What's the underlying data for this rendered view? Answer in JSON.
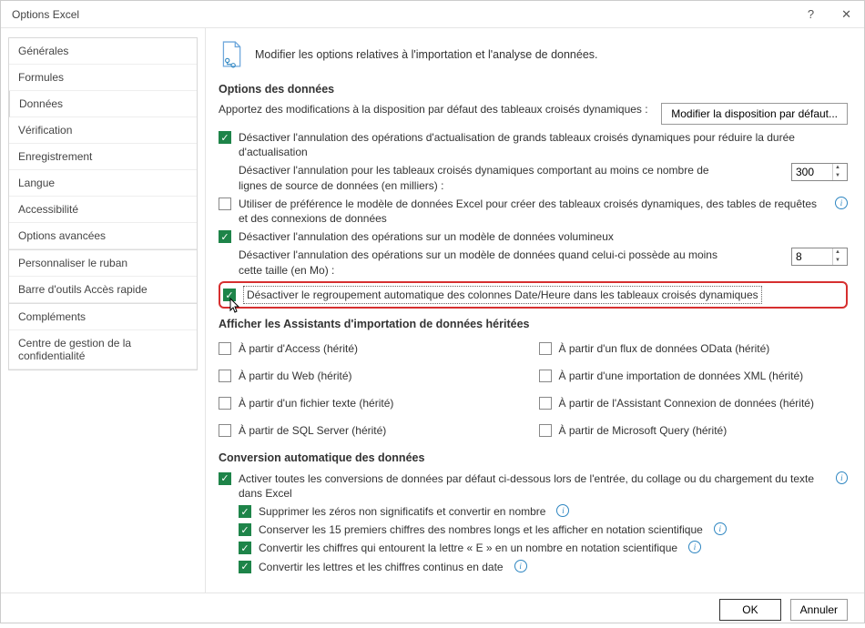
{
  "window": {
    "title": "Options Excel",
    "help": "?",
    "close": "✕"
  },
  "sidebar": {
    "items": [
      {
        "label": "Générales"
      },
      {
        "label": "Formules"
      },
      {
        "label": "Données"
      },
      {
        "label": "Vérification"
      },
      {
        "label": "Enregistrement"
      },
      {
        "label": "Langue"
      },
      {
        "label": "Accessibilité"
      },
      {
        "label": "Options avancées"
      },
      {
        "label": "Personnaliser le ruban"
      },
      {
        "label": "Barre d'outils Accès rapide"
      },
      {
        "label": "Compléments"
      },
      {
        "label": "Centre de gestion de la confidentialité"
      }
    ]
  },
  "header": {
    "text": "Modifier les options relatives à l'importation et l'analyse de données."
  },
  "section_data": {
    "title": "Options des données",
    "intro": "Apportez des modifications à la disposition par défaut des tableaux croisés dynamiques :",
    "layout_button": "Modifier la disposition par défaut...",
    "opt1": "Désactiver l'annulation des opérations d'actualisation de grands tableaux croisés dynamiques pour réduire la durée d'actualisation",
    "opt1_sub": "Désactiver l'annulation pour les tableaux croisés dynamiques comportant au moins ce nombre de lignes de source de données (en milliers) :",
    "opt1_val": "300",
    "opt2": "Utiliser de préférence le modèle de données Excel pour créer des tableaux croisés dynamiques, des tables de requêtes et des connexions de données",
    "opt3": "Désactiver l'annulation des opérations sur un modèle de données volumineux",
    "opt3_sub": "Désactiver l'annulation des opérations sur un modèle de données quand celui-ci possède au moins cette taille (en Mo) :",
    "opt3_val": "8",
    "opt4": "Désactiver le regroupement automatique des colonnes Date/Heure dans les tableaux croisés dynamiques"
  },
  "section_legacy": {
    "title": "Afficher les Assistants d'importation de données héritées",
    "left": [
      "À partir d'Access (hérité)",
      "À partir du Web (hérité)",
      "À partir d'un fichier texte (hérité)",
      "À partir de SQL Server (hérité)"
    ],
    "right": [
      "À partir d'un flux de données OData (hérité)",
      "À partir d'une importation de données XML (hérité)",
      "À partir de l'Assistant Connexion de données (hérité)",
      "À partir de Microsoft Query (hérité)"
    ]
  },
  "section_conv": {
    "title": "Conversion automatique des données",
    "main": "Activer toutes les conversions de données par défaut ci-dessous lors de l'entrée, du collage ou du chargement du texte dans Excel",
    "subs": [
      "Supprimer les zéros non significatifs et convertir en nombre",
      "Conserver les 15 premiers chiffres des nombres longs et les afficher en notation scientifique",
      "Convertir les chiffres qui entourent la lettre « E » en un nombre en notation scientifique",
      "Convertir les lettres et les chiffres continus en date"
    ]
  },
  "footer": {
    "ok": "OK",
    "cancel": "Annuler"
  }
}
